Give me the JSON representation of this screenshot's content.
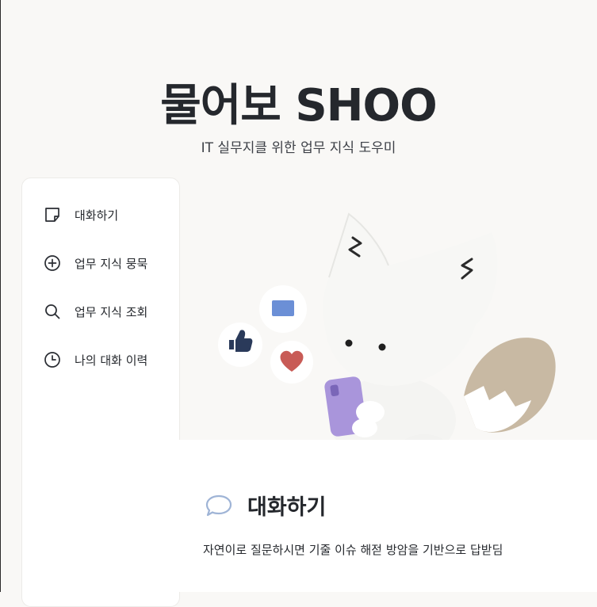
{
  "app": {
    "title": "물어보 SHOO",
    "subtitle": "IT 실무지클 위한 업무 지식 도우미"
  },
  "sidebar": {
    "items": [
      {
        "label": "대화하기",
        "icon": "chat-note-icon"
      },
      {
        "label": "업무 지식 뭉묵",
        "icon": "plus-circle-icon"
      },
      {
        "label": "업무 지식 조회",
        "icon": "search-icon"
      },
      {
        "label": "나의 대화 이력",
        "icon": "clock-icon"
      }
    ]
  },
  "main": {
    "section_title": "대화하기",
    "section_icon": "speech-bubble-icon",
    "description": "자연이로 질문하시면 기줄 이슈 해젇 방암을 기반으로 답받딤"
  },
  "colors": {
    "background": "#f9f8f6",
    "panel": "#ffffff",
    "text": "#25282d",
    "icon_blue": "#9fb4d6",
    "phone_purple": "#a995db",
    "heart_red": "#c85b56",
    "message_blue": "#6b8fd6",
    "tail_tan": "#c8b9a3"
  }
}
